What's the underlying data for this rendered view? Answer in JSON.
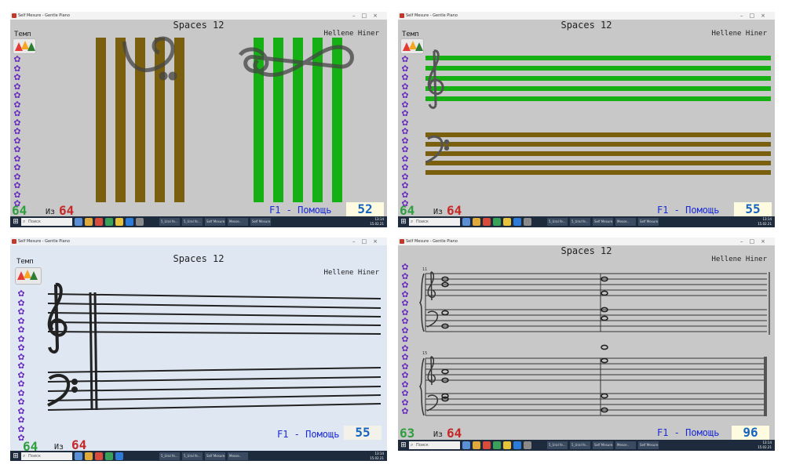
{
  "app": {
    "window_title": "Self Mesure - Gentle Piano",
    "title": "Spaces 12",
    "author": "Hellene Hiner"
  },
  "tempo": {
    "label": "Темп"
  },
  "progress": {
    "of_label": "Из",
    "total": "64"
  },
  "help": {
    "label": "F1 - Помощь"
  },
  "panels": [
    {
      "current": "64",
      "score": "52"
    },
    {
      "current": "64",
      "score": "55"
    },
    {
      "current": "64",
      "score": "55"
    },
    {
      "current": "63",
      "score": "96"
    }
  ],
  "score_panel": {
    "measure_a": "11",
    "measure_b": "15"
  },
  "taskbar": {
    "search_placeholder": "Поиск",
    "tasks": [
      "5_Ural fe...",
      "5_Ural fe...",
      "Self Mesure...",
      "Self Mesure...",
      "Messe..",
      "Self Mesure..."
    ],
    "clock_time": "13:14",
    "clock_date": "15.02.21",
    "lang": "РУС"
  },
  "colors": {
    "green_staff": "#14b014",
    "brown_staff": "#7a5f0e",
    "flower": "#6a2fbf",
    "count_current": "#2e9e3f",
    "count_total": "#c62828",
    "help_text": "#1a2bd6",
    "score_text": "#1565c0"
  },
  "icons": [
    "windows-start-icon",
    "search-icon",
    "flower-icon",
    "tempo-gauge-icon",
    "treble-clef-icon",
    "bass-clef-icon",
    "whole-note-icon",
    "minimize-icon",
    "maximize-icon",
    "close-icon"
  ]
}
